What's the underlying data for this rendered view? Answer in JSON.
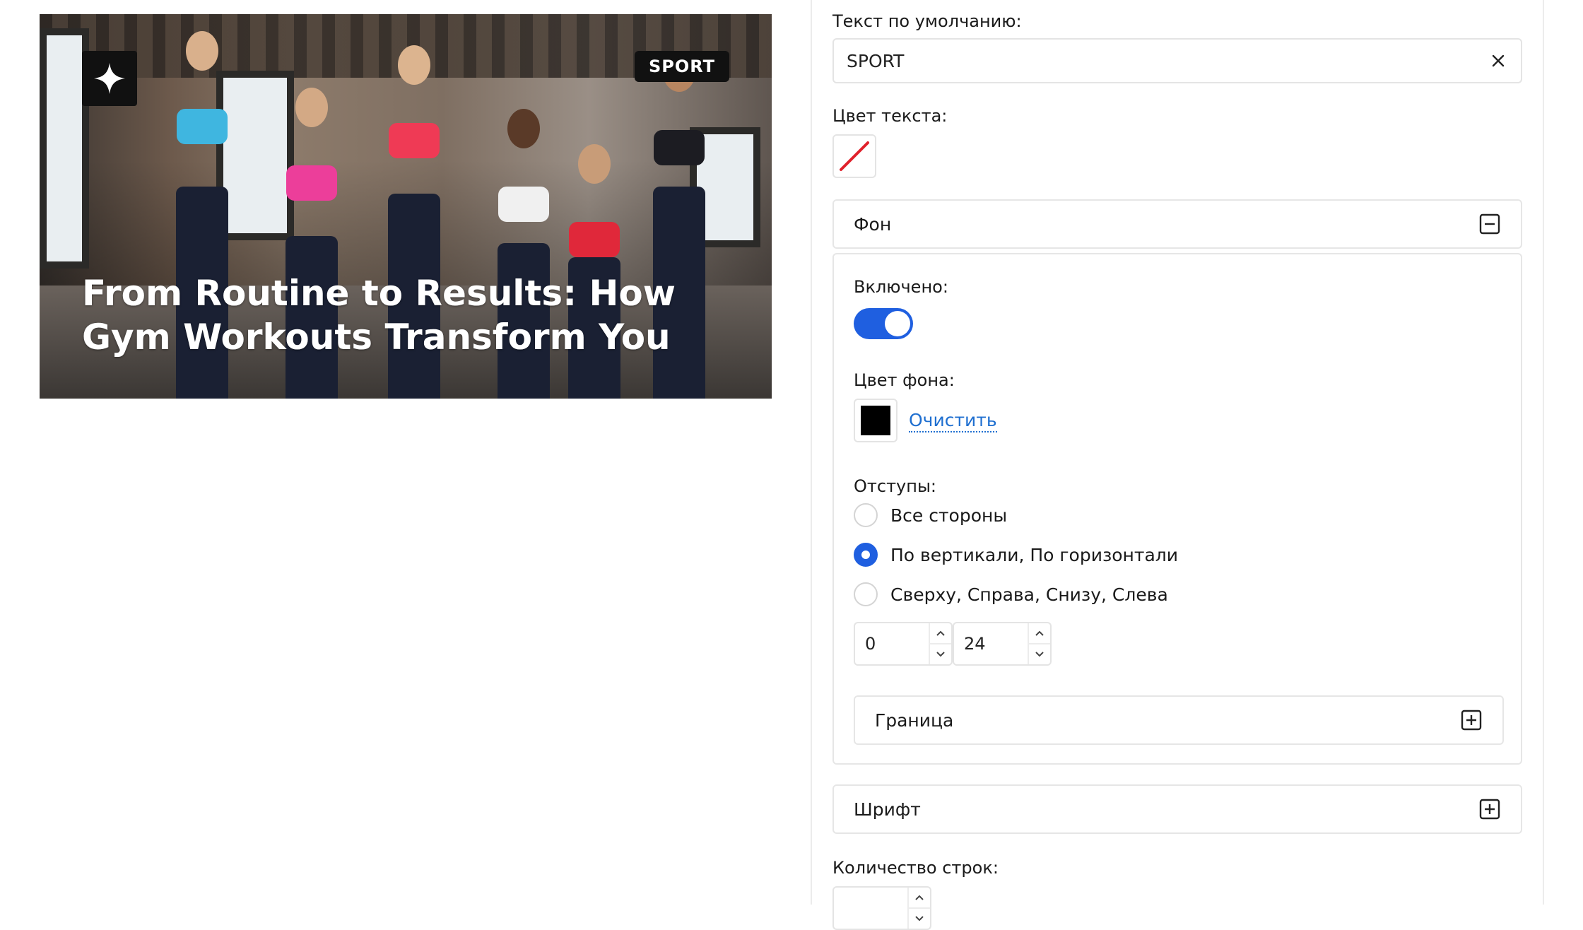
{
  "preview": {
    "badge": "SPORT",
    "title": "From Routine to Results: How Gym Workouts Transform You",
    "logo_icon": "sparkle-icon"
  },
  "settings": {
    "default_text_label": "Текст по умолчанию:",
    "default_text_value": "SPORT",
    "text_color_label": "Цвет текста:",
    "background_section": "Фон",
    "enabled_label": "Включено:",
    "bg_color_label": "Цвет фона:",
    "bg_color_value": "#000000",
    "clear_link": "Очистить",
    "padding_label": "Отступы:",
    "padding_options": [
      "Все стороны",
      "По вертикали, По горизонтали",
      "Сверху, Справа, Снизу, Слева"
    ],
    "padding_selected_index": 1,
    "padding_vertical": "0",
    "padding_horizontal": "24",
    "border_section": "Граница",
    "font_section": "Шрифт",
    "line_count_label": "Количество строк:"
  },
  "colors": {
    "accent": "#1f5fe0",
    "link": "#1f6fd0",
    "no_color_slash": "#e0202a"
  }
}
